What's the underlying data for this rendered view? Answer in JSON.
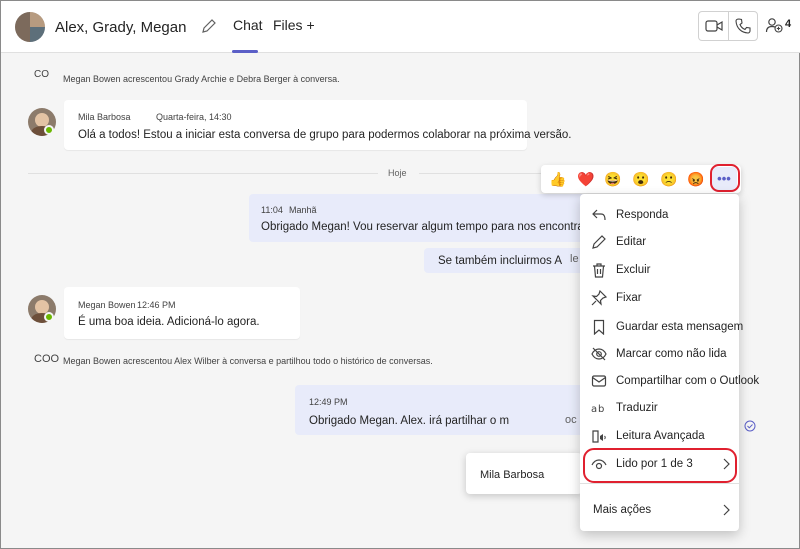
{
  "header": {
    "chat_title": "Alex, Grady, Megan",
    "tabs": [
      {
        "label": "Chat"
      },
      {
        "label": "Files +"
      }
    ],
    "people_count": "4"
  },
  "system_messages": [
    {
      "icon_text": "CO",
      "text": "Megan Bowen acrescentou Grady Archie e Debra Berger à conversa."
    },
    {
      "icon_text": "COO",
      "text": "Megan Bowen acrescentou Alex Wilber à conversa e partilhou todo o histórico de conversas."
    }
  ],
  "messages": [
    {
      "author": "Mila Barbosa",
      "time": "Quarta-feira, 14:30",
      "text": "Olá a todos! Estou a iniciar esta conversa de grupo para podermos colaborar na próxima versão."
    },
    {
      "time": "11:04",
      "time_suffix": "Manhã",
      "text": "Obrigado Megan! Vou reservar algum tempo para nos encontrarmos."
    },
    {
      "text": "Se também incluirmos A",
      "trailing": "le"
    },
    {
      "author": "Megan Bowen",
      "time": "12:46 PM",
      "text": "É uma boa ideia. Adicioná-lo agora."
    },
    {
      "time": "12:49 PM",
      "text": "Obrigado Megan. Alex. irá partilhar o m",
      "trailing": "oc"
    }
  ],
  "divider": {
    "label": "Hoje"
  },
  "reactions": [
    "👍",
    "❤️",
    "😆",
    "😮",
    "🙁",
    "😡"
  ],
  "more_button": {
    "label": "•••"
  },
  "context_menu": {
    "items": [
      {
        "label": "Responda",
        "icon": "reply-icon"
      },
      {
        "label": "Editar",
        "icon": "pencil-icon"
      },
      {
        "label": "Excluir",
        "icon": "trash-icon"
      },
      {
        "label": "Fixar",
        "icon": "pin-icon"
      },
      {
        "label": "Guardar esta mensagem",
        "icon": "bookmark-icon"
      },
      {
        "label": "Marcar como não lida",
        "icon": "eye-off-icon"
      },
      {
        "label": "Compartilhar com o Outlook",
        "icon": "mail-icon"
      },
      {
        "label": "Traduzir",
        "icon": "translate-icon"
      },
      {
        "label": "Leitura Avançada",
        "icon": "immersive-reader-icon"
      },
      {
        "label": "Lido por 1 de 3",
        "icon": "eye-icon"
      },
      {
        "label": "Mais ações",
        "icon": "chevron-right-icon"
      }
    ]
  },
  "read_by_popup": {
    "name": "Mila Barbosa"
  },
  "colors": {
    "accent": "#5b5fc7",
    "highlight_ring": "#e0202f",
    "online": "#6bb700",
    "outgoing_bubble": "#e8ebfa"
  }
}
